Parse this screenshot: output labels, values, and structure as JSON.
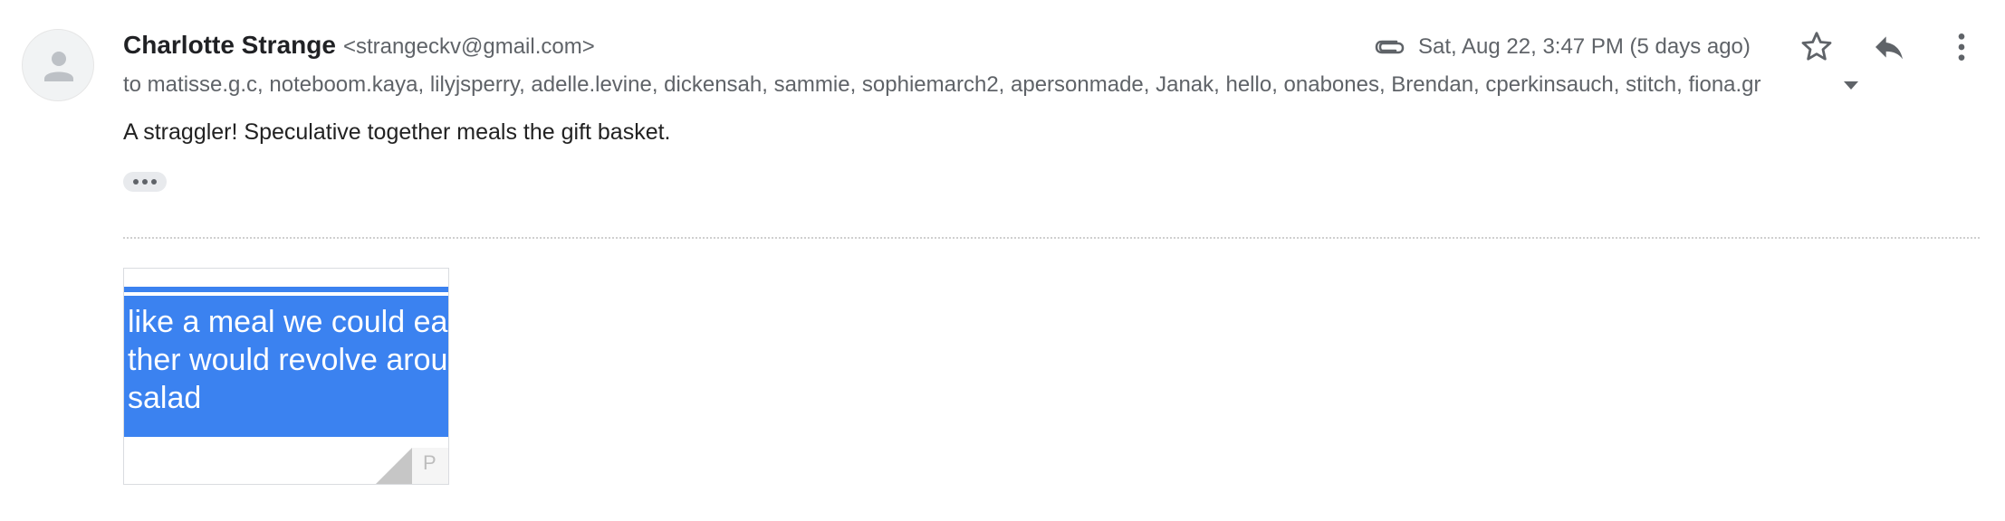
{
  "sender": {
    "name": "Charlotte Strange",
    "email": "<strangeckv@gmail.com>"
  },
  "recipients": {
    "text": "to matisse.g.c, noteboom.kaya, lilyjsperry, adelle.levine, dickensah, sammie, sophiemarch2, apersonmade, Janak, hello, onabones, Brendan, cperkinsauch, stitch, fiona.gr"
  },
  "meta": {
    "date": "Sat, Aug 22, 3:47 PM (5 days ago)"
  },
  "body": {
    "text": "A straggler! Speculative together meals the gift basket."
  },
  "attachment": {
    "lines": [
      " like a meal we could ea",
      "ther would revolve arou",
      " salad"
    ],
    "corner_letter": "P"
  },
  "icons": {
    "avatar": "person-icon",
    "attachment": "paperclip-icon",
    "star": "star-outline-icon",
    "reply": "reply-icon",
    "more": "more-vertical-icon",
    "expand": "caret-down-icon",
    "trimmed": "ellipsis-icon"
  },
  "colors": {
    "accent_blue": "#3b82f0",
    "text_primary": "#202124",
    "text_secondary": "#5f6368"
  }
}
